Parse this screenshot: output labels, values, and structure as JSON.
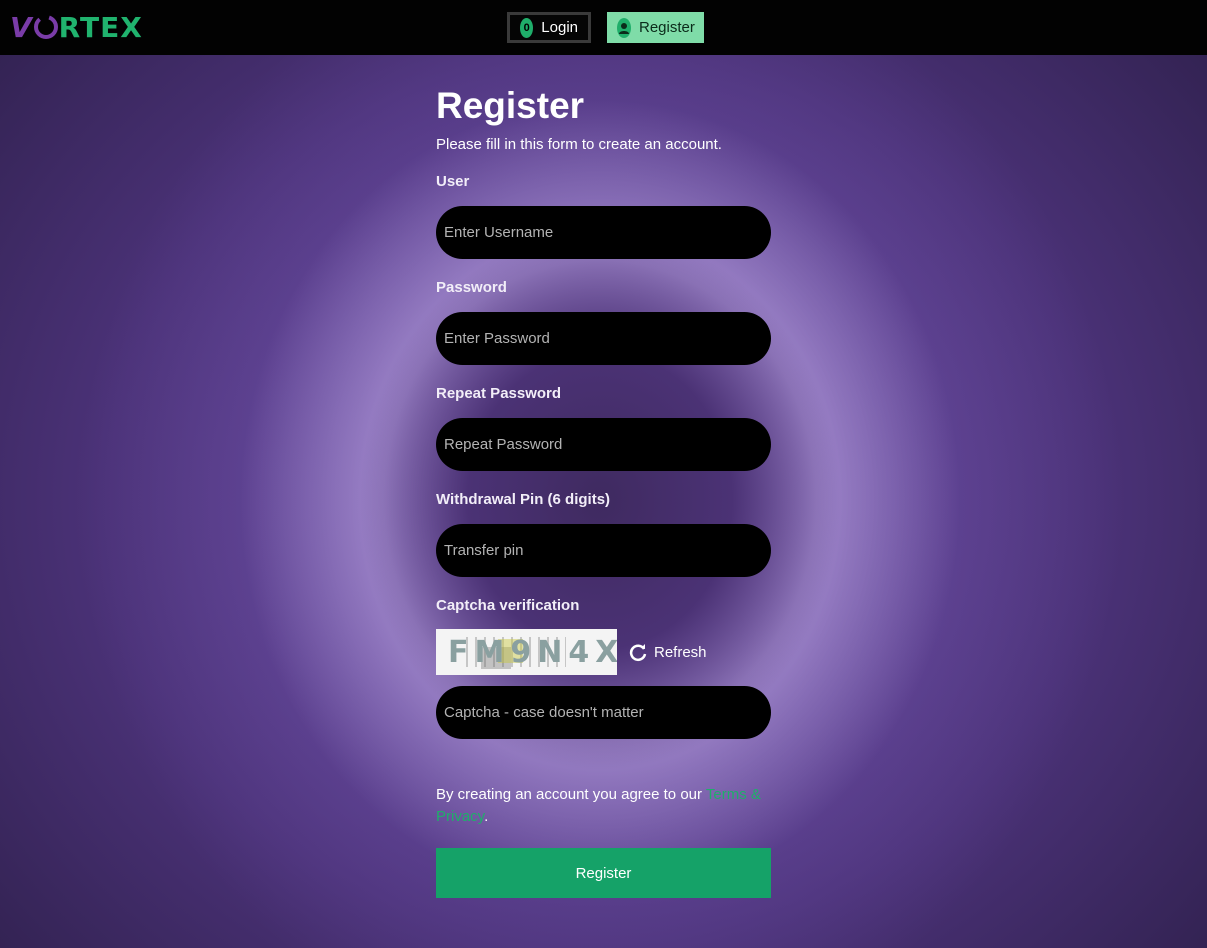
{
  "header": {
    "logo_first": "V",
    "logo_rest": "RTEX",
    "login_label": "Login",
    "register_label": "Register"
  },
  "form": {
    "title": "Register",
    "subtitle": "Please fill in this form to create an account.",
    "user_label": "User",
    "user_placeholder": "Enter Username",
    "password_label": "Password",
    "password_placeholder": "Enter Password",
    "repeat_label": "Repeat Password",
    "repeat_placeholder": "Repeat Password",
    "pin_label": "Withdrawal Pin (6 digits)",
    "pin_placeholder": "Transfer pin",
    "captcha_label": "Captcha verification",
    "captcha_text": "FM9N4X",
    "refresh_label": "Refresh",
    "captcha_placeholder": "Captcha - case doesn't matter",
    "terms_prefix": "By creating an account you agree to our ",
    "terms_link": "Terms & Privacy",
    "terms_suffix": ".",
    "submit_label": "Register"
  },
  "colors": {
    "accent": "#15a268",
    "logo_purple": "#7a3ca8",
    "background": "#4b3278"
  }
}
